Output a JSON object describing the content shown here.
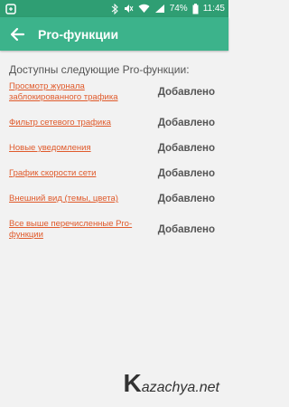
{
  "status_bar": {
    "battery": "74%",
    "time": "11:45"
  },
  "app_bar": {
    "title": "Pro-функции"
  },
  "content": {
    "heading": "Доступны следующие Pro-функции:",
    "features": [
      {
        "label": "Просмотр журнала заблокированного трафика",
        "status": "Добавлено"
      },
      {
        "label": "Фильтр сетевого трафика",
        "status": "Добавлено"
      },
      {
        "label": "Новые уведомления",
        "status": "Добавлено"
      },
      {
        "label": "График скорости сети",
        "status": "Добавлено"
      },
      {
        "label": "Внешний вид (темы, цвета)",
        "status": "Добавлено"
      },
      {
        "label": "Все выше перечисленные Pro-функции",
        "status": "Добавлено"
      }
    ]
  },
  "watermark": {
    "k": "K",
    "rest": "azachya.net"
  }
}
